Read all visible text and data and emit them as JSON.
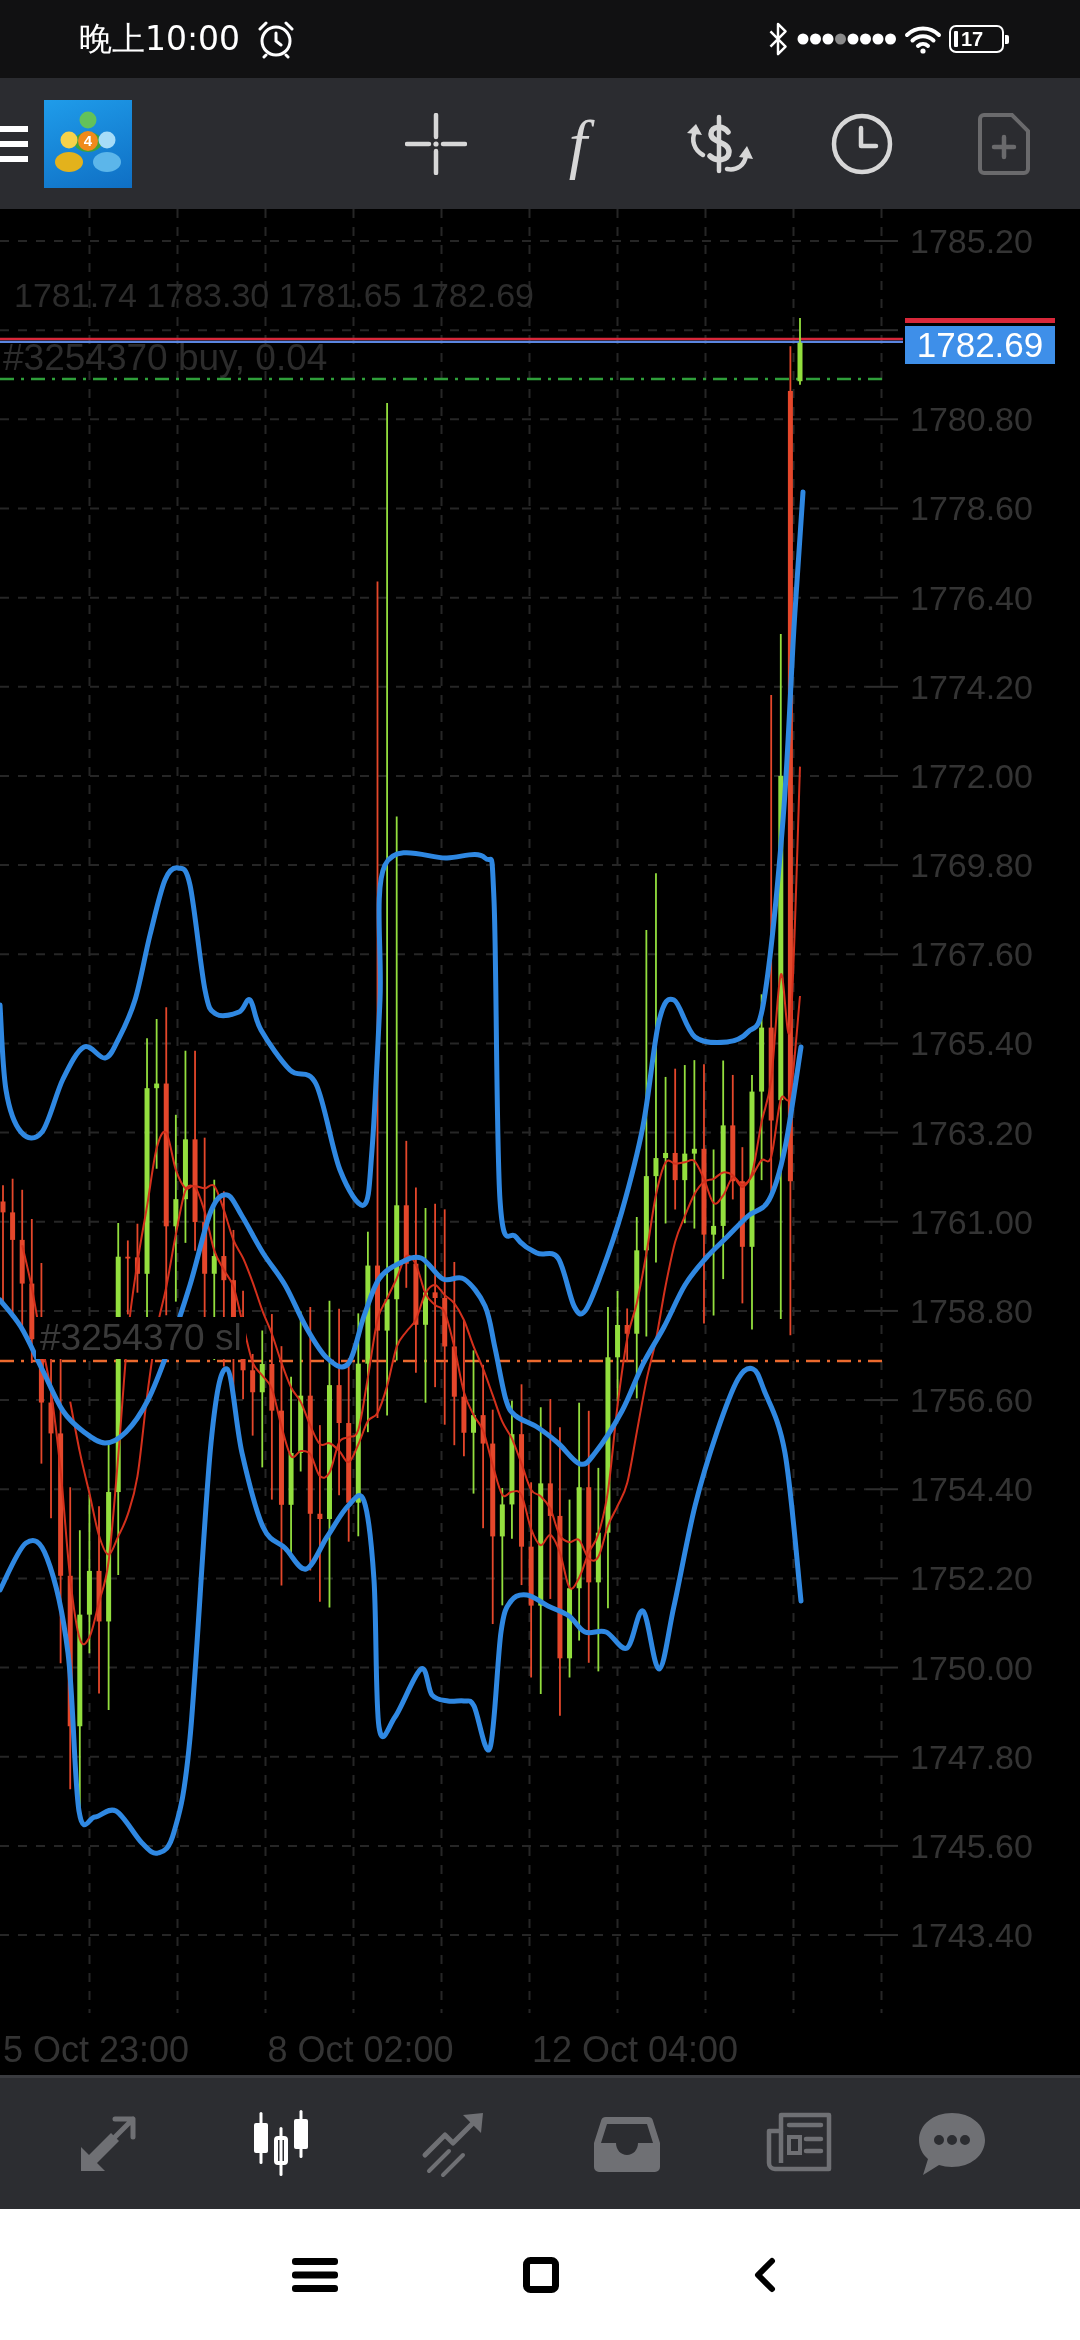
{
  "status_bar": {
    "time": "晚上10:00",
    "battery": "17"
  },
  "toolbar": {
    "logo_badge": "4",
    "buttons": [
      {
        "kind": "crosshair",
        "disabled": false
      },
      {
        "kind": "function",
        "label": "f",
        "disabled": false
      },
      {
        "kind": "trade",
        "disabled": false
      },
      {
        "kind": "period",
        "disabled": false
      },
      {
        "kind": "new_document",
        "disabled": true
      }
    ]
  },
  "chart": {
    "ohlc": "1781.74 1783.30 1781.65 1782.69",
    "current_price": "1782.69",
    "orders": [
      {
        "kind": "entry",
        "label": "#3254370 buy, 0.04"
      },
      {
        "kind": "stop_loss",
        "label": "#3254370 sl"
      }
    ],
    "price_axis": [
      "1785.20",
      "1780.80",
      "1778.60",
      "1776.40",
      "1774.20",
      "1772.00",
      "1769.80",
      "1767.60",
      "1765.40",
      "1763.20",
      "1761.00",
      "1758.80",
      "1756.60",
      "1754.40",
      "1752.20",
      "1750.00",
      "1747.80",
      "1745.60",
      "1743.40"
    ],
    "time_axis": [
      "5 Oct 23:00",
      "8 Oct 02:00",
      "12 Oct 04:00"
    ]
  },
  "tabs": [
    {
      "kind": "quotes",
      "selected": false
    },
    {
      "kind": "chart",
      "selected": true
    },
    {
      "kind": "trade",
      "selected": false
    },
    {
      "kind": "history",
      "selected": false
    },
    {
      "kind": "news",
      "selected": false
    },
    {
      "kind": "chat",
      "selected": false
    }
  ]
}
